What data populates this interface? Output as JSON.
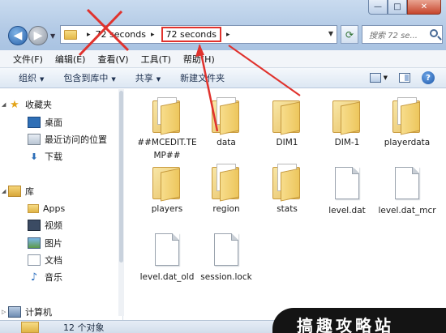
{
  "window": {
    "buttons": {
      "minimize": "—",
      "maximize": "□",
      "close": "✕"
    }
  },
  "address": {
    "crumbs": [
      "72 seconds",
      "72 seconds"
    ],
    "separator": "▸",
    "search_placeholder": "搜索 72 se..."
  },
  "menu": [
    "文件(F)",
    "编辑(E)",
    "查看(V)",
    "工具(T)",
    "帮助(H)"
  ],
  "toolbar": [
    "组织",
    "包含到库中",
    "共享",
    "新建文件夹"
  ],
  "nav_pane": {
    "favorites": {
      "label": "收藏夹",
      "items": [
        "桌面",
        "最近访问的位置",
        "下载"
      ]
    },
    "libraries": {
      "label": "库",
      "items": [
        "Apps",
        "视频",
        "图片",
        "文档",
        "音乐"
      ]
    },
    "computer": {
      "label": "计算机"
    }
  },
  "files": [
    {
      "name": "##MCEDIT.TEMP##",
      "type": "folder"
    },
    {
      "name": "data",
      "type": "folder"
    },
    {
      "name": "DIM1",
      "type": "folder"
    },
    {
      "name": "DIM-1",
      "type": "folder"
    },
    {
      "name": "playerdata",
      "type": "folder"
    },
    {
      "name": "players",
      "type": "folder"
    },
    {
      "name": "region",
      "type": "folder"
    },
    {
      "name": "stats",
      "type": "folder"
    },
    {
      "name": "level.dat",
      "type": "file"
    },
    {
      "name": "level.dat_mcr",
      "type": "file"
    },
    {
      "name": "level.dat_old",
      "type": "file"
    },
    {
      "name": "session.lock",
      "type": "file"
    }
  ],
  "status": {
    "count": "12 个对象"
  },
  "watermark": "搞趣攻略站",
  "colors": {
    "annotation": "#e0322d",
    "address_border": "#7f94b5"
  }
}
